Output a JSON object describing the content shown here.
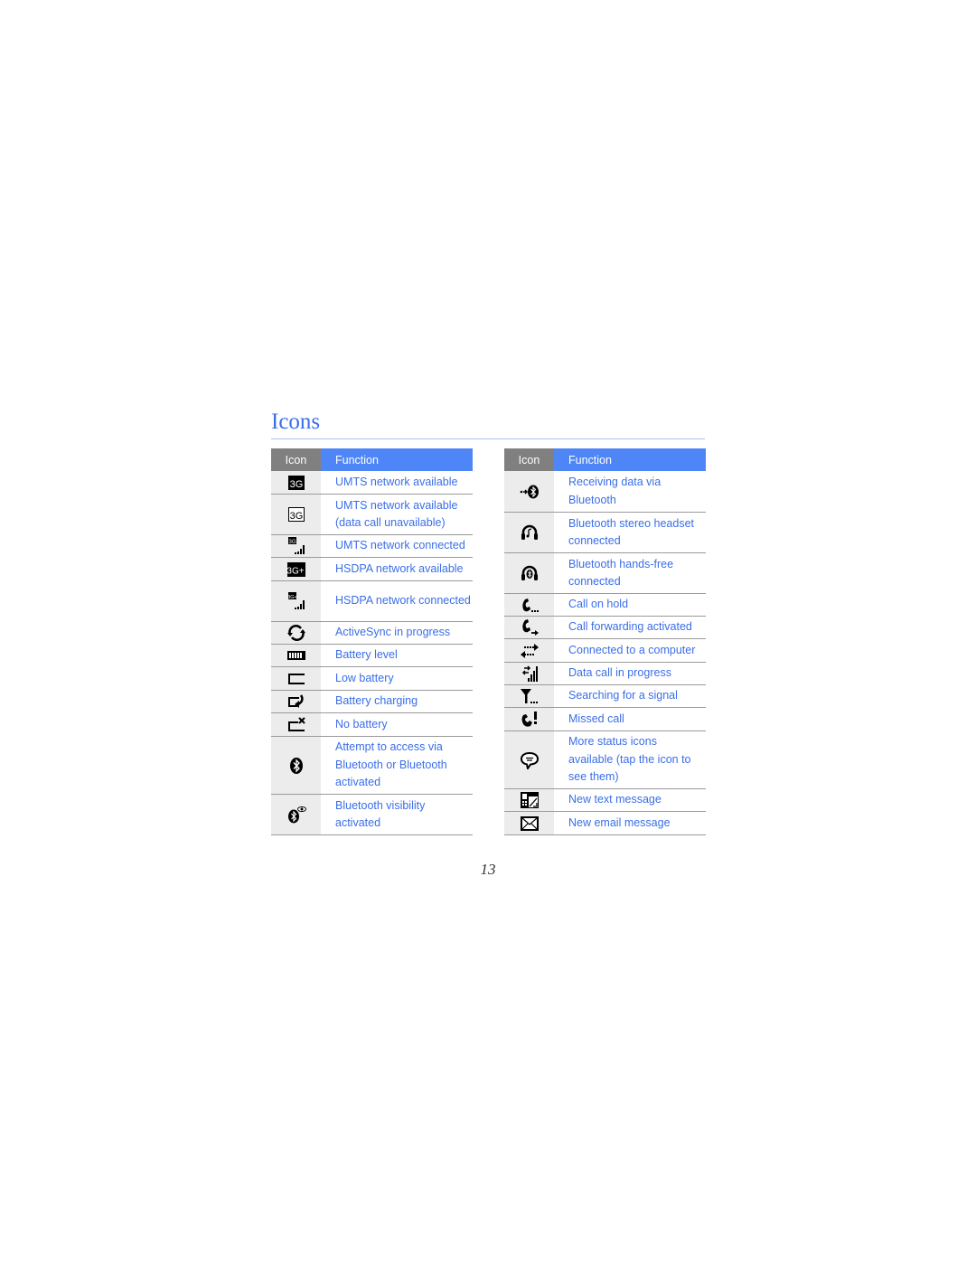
{
  "page": {
    "title": "Icons",
    "page_number": "13",
    "accent_color": "#3a6ee8",
    "header_icon_bg": "#808080",
    "header_function_bg": "#4f86f7"
  },
  "tables": [
    {
      "header": {
        "icon": "Icon",
        "function": "Function"
      },
      "rows": [
        {
          "icon": "umts-3g-filled-icon",
          "function": "UMTS network available"
        },
        {
          "icon": "umts-3g-outline-icon",
          "function": "UMTS network available (data call unavailable)"
        },
        {
          "icon": "umts-connected-signal-icon",
          "function": "UMTS network connected"
        },
        {
          "icon": "hsdpa-3g-plus-icon",
          "function": "HSDPA network available"
        },
        {
          "icon": "hsdpa-connected-signal-icon",
          "function": "HSDPA network connected"
        },
        {
          "icon": "activesync-arrows-icon",
          "function": "ActiveSync in progress"
        },
        {
          "icon": "battery-full-icon",
          "function": "Battery level"
        },
        {
          "icon": "battery-empty-icon",
          "function": "Low battery"
        },
        {
          "icon": "battery-charging-icon",
          "function": "Battery charging"
        },
        {
          "icon": "no-battery-icon",
          "function": "No battery"
        },
        {
          "icon": "bluetooth-icon",
          "function": "Attempt to access via Bluetooth or Bluetooth activated"
        },
        {
          "icon": "bluetooth-visibility-icon",
          "function": "Bluetooth visibility activated"
        }
      ]
    },
    {
      "header": {
        "icon": "Icon",
        "function": "Function"
      },
      "rows": [
        {
          "icon": "bluetooth-receive-icon",
          "function": "Receiving data via Bluetooth"
        },
        {
          "icon": "stereo-headset-icon",
          "function": "Bluetooth stereo headset connected"
        },
        {
          "icon": "handsfree-headset-icon",
          "function": "Bluetooth hands-free connected"
        },
        {
          "icon": "call-hold-icon",
          "function": "Call on hold"
        },
        {
          "icon": "call-forward-icon",
          "function": "Call forwarding activated"
        },
        {
          "icon": "computer-connected-icon",
          "function": "Connected to a computer"
        },
        {
          "icon": "data-call-icon",
          "function": "Data call in progress"
        },
        {
          "icon": "searching-signal-icon",
          "function": "Searching for a signal"
        },
        {
          "icon": "missed-call-icon",
          "function": "Missed call"
        },
        {
          "icon": "more-status-bubble-icon",
          "function": "More status icons available (tap the icon to see them)"
        },
        {
          "icon": "new-text-message-icon",
          "function": "New text message"
        },
        {
          "icon": "new-email-icon",
          "function": "New email message"
        }
      ]
    }
  ]
}
